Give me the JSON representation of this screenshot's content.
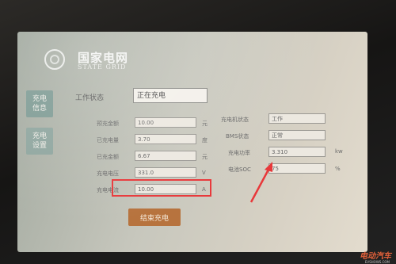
{
  "brand": {
    "name_cn": "国家电网",
    "name_en": "STATE GRID"
  },
  "side_menu": [
    {
      "label": "充电\n信息"
    },
    {
      "label": "充电\n设置"
    }
  ],
  "status": {
    "label": "工作状态",
    "value": "正在充电"
  },
  "left_fields": [
    {
      "label": "预充金额",
      "value": "10.00",
      "unit": "元"
    },
    {
      "label": "已充电量",
      "value": "3.70",
      "unit": "度"
    },
    {
      "label": "已充金额",
      "value": "6.67",
      "unit": "元"
    },
    {
      "label": "充电电压",
      "value": "331.0",
      "unit": "V"
    },
    {
      "label": "充电电流",
      "value": "10.00",
      "unit": "A"
    }
  ],
  "right_fields": [
    {
      "label": "充电机状态",
      "value": "工作",
      "unit": ""
    },
    {
      "label": "BMS状态",
      "value": "正常",
      "unit": ""
    },
    {
      "label": "充电功率",
      "value": "3.310",
      "unit": "kw"
    },
    {
      "label": "电池SOC",
      "value": "75",
      "unit": "%"
    }
  ],
  "stop_button": {
    "label": "结束充电"
  },
  "watermark": {
    "text": "电动汽车",
    "sub": "EVSHOWS.COM"
  },
  "colors": {
    "highlight": "#e8383a",
    "button": "#b7733e"
  }
}
